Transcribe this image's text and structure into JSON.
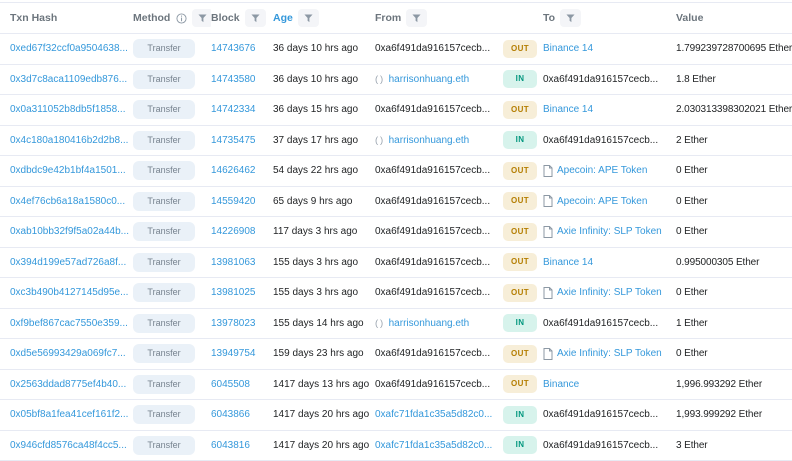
{
  "header": {
    "txn_hash": "Txn Hash",
    "method": "Method",
    "block": "Block",
    "age": "Age",
    "from": "From",
    "to": "To",
    "value": "Value"
  },
  "colors": {
    "link_blue": "#3498db",
    "sorted_column_blue": "#3498db",
    "out_badge_text": "#b47d00",
    "out_badge_bg": "#f7eed8",
    "in_badge_text": "#02977e",
    "in_badge_bg": "#d7f3ec",
    "method_badge_bg": "#eaf1f8",
    "method_badge_text": "#77838f",
    "row_border": "#e7eaf3"
  },
  "rows": [
    {
      "hash": "0xed67f32ccf0a9504638...",
      "method": "Transfer",
      "block": "14743676",
      "age": "36 days 10 hrs ago",
      "from": "0xa6f491da916157cecb...",
      "from_type": "self",
      "dir": "OUT",
      "to": "Binance 14",
      "to_type": "name",
      "value": "1.799239728700695 Ether"
    },
    {
      "hash": "0x3d7c8aca1109edb876...",
      "method": "Transfer",
      "block": "14743580",
      "age": "36 days 10 hrs ago",
      "from": "harrisonhuang.eth",
      "from_type": "ens",
      "dir": "IN",
      "to": "0xa6f491da916157cecb...",
      "to_type": "self",
      "value": "1.8 Ether"
    },
    {
      "hash": "0x0a311052b8db5f1858...",
      "method": "Transfer",
      "block": "14742334",
      "age": "36 days 15 hrs ago",
      "from": "0xa6f491da916157cecb...",
      "from_type": "self",
      "dir": "OUT",
      "to": "Binance 14",
      "to_type": "name",
      "value": "2.030313398302021 Ether"
    },
    {
      "hash": "0x4c180a180416b2d2b8...",
      "method": "Transfer",
      "block": "14735475",
      "age": "37 days 17 hrs ago",
      "from": "harrisonhuang.eth",
      "from_type": "ens",
      "dir": "IN",
      "to": "0xa6f491da916157cecb...",
      "to_type": "self",
      "value": "2 Ether"
    },
    {
      "hash": "0xdbdc9e42b1bf4a1501...",
      "method": "Transfer",
      "block": "14626462",
      "age": "54 days 22 hrs ago",
      "from": "0xa6f491da916157cecb...",
      "from_type": "self",
      "dir": "OUT",
      "to": "Apecoin: APE Token",
      "to_type": "token",
      "value": "0 Ether"
    },
    {
      "hash": "0x4ef76cb6a18a1580c0...",
      "method": "Transfer",
      "block": "14559420",
      "age": "65 days 9 hrs ago",
      "from": "0xa6f491da916157cecb...",
      "from_type": "self",
      "dir": "OUT",
      "to": "Apecoin: APE Token",
      "to_type": "token",
      "value": "0 Ether"
    },
    {
      "hash": "0xab10bb32f9f5a02a44b...",
      "method": "Transfer",
      "block": "14226908",
      "age": "117 days 3 hrs ago",
      "from": "0xa6f491da916157cecb...",
      "from_type": "self",
      "dir": "OUT",
      "to": "Axie Infinity: SLP Token",
      "to_type": "token",
      "value": "0 Ether"
    },
    {
      "hash": "0x394d199e57ad726a8f...",
      "method": "Transfer",
      "block": "13981063",
      "age": "155 days 3 hrs ago",
      "from": "0xa6f491da916157cecb...",
      "from_type": "self",
      "dir": "OUT",
      "to": "Binance 14",
      "to_type": "name",
      "value": "0.995000305 Ether"
    },
    {
      "hash": "0xc3b490b4127145d95e...",
      "method": "Transfer",
      "block": "13981025",
      "age": "155 days 3 hrs ago",
      "from": "0xa6f491da916157cecb...",
      "from_type": "self",
      "dir": "OUT",
      "to": "Axie Infinity: SLP Token",
      "to_type": "token",
      "value": "0 Ether"
    },
    {
      "hash": "0xf9bef867cac7550e359...",
      "method": "Transfer",
      "block": "13978023",
      "age": "155 days 14 hrs ago",
      "from": "harrisonhuang.eth",
      "from_type": "ens",
      "dir": "IN",
      "to": "0xa6f491da916157cecb...",
      "to_type": "self",
      "value": "1 Ether"
    },
    {
      "hash": "0xd5e56993429a069fc7...",
      "method": "Transfer",
      "block": "13949754",
      "age": "159 days 23 hrs ago",
      "from": "0xa6f491da916157cecb...",
      "from_type": "self",
      "dir": "OUT",
      "to": "Axie Infinity: SLP Token",
      "to_type": "token",
      "value": "0 Ether"
    },
    {
      "hash": "0x2563ddad8775ef4b40...",
      "method": "Transfer",
      "block": "6045508",
      "age": "1417 days 13 hrs ago",
      "from": "0xa6f491da916157cecb...",
      "from_type": "self",
      "dir": "OUT",
      "to": "Binance",
      "to_type": "name",
      "value": "1,996.993292 Ether"
    },
    {
      "hash": "0x05bf8a1fea41cef161f2...",
      "method": "Transfer",
      "block": "6043866",
      "age": "1417 days 20 hrs ago",
      "from": "0xafc71fda1c35a5d82c0...",
      "from_type": "address",
      "dir": "IN",
      "to": "0xa6f491da916157cecb...",
      "to_type": "self",
      "value": "1,993.999292 Ether"
    },
    {
      "hash": "0x946cfd8576ca48f4cc5...",
      "method": "Transfer",
      "block": "6043816",
      "age": "1417 days 20 hrs ago",
      "from": "0xafc71fda1c35a5d82c0...",
      "from_type": "address",
      "dir": "IN",
      "to": "0xa6f491da916157cecb...",
      "to_type": "self",
      "value": "3 Ether"
    }
  ]
}
